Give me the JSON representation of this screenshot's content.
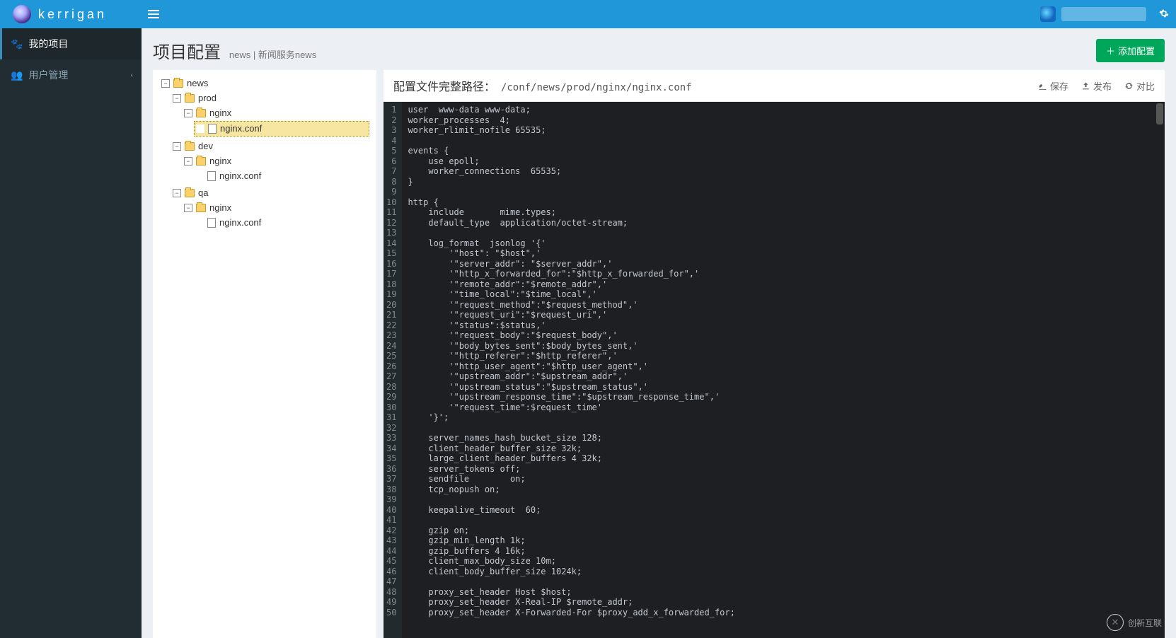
{
  "brand": "kerrigan",
  "sidebar": {
    "items": [
      {
        "label": "我的项目",
        "icon": "paw"
      },
      {
        "label": "用户管理",
        "icon": "users"
      }
    ]
  },
  "page": {
    "title": "项目配置",
    "crumb": "news | 新闻服务news",
    "addButton": "添加配置"
  },
  "tree": {
    "root": "news",
    "children": [
      {
        "name": "prod",
        "children": [
          {
            "name": "nginx",
            "children": [
              {
                "name": "nginx.conf",
                "file": true,
                "selected": true
              }
            ]
          }
        ]
      },
      {
        "name": "dev",
        "children": [
          {
            "name": "nginx",
            "children": [
              {
                "name": "nginx.conf",
                "file": true
              }
            ]
          }
        ]
      },
      {
        "name": "qa",
        "children": [
          {
            "name": "nginx",
            "children": [
              {
                "name": "nginx.conf",
                "file": true
              }
            ]
          }
        ]
      }
    ]
  },
  "editor": {
    "pathLabel": "配置文件完整路径：",
    "pathValue": "/conf/news/prod/nginx/nginx.conf",
    "actions": {
      "save": "保存",
      "publish": "发布",
      "diff": "对比"
    },
    "lines": [
      "user  www-data www-data;",
      "worker_processes  4;",
      "worker_rlimit_nofile 65535;",
      "",
      "events {",
      "    use epoll;",
      "    worker_connections  65535;",
      "}",
      "",
      "http {",
      "    include       mime.types;",
      "    default_type  application/octet-stream;",
      "",
      "    log_format  jsonlog '{'",
      "        '\"host\": \"$host\",'",
      "        '\"server_addr\": \"$server_addr\",'",
      "        '\"http_x_forwarded_for\":\"$http_x_forwarded_for\",'",
      "        '\"remote_addr\":\"$remote_addr\",'",
      "        '\"time_local\":\"$time_local\",'",
      "        '\"request_method\":\"$request_method\",'",
      "        '\"request_uri\":\"$request_uri\",'",
      "        '\"status\":$status,'",
      "        '\"request_body\":\"$request_body\",'",
      "        '\"body_bytes_sent\":$body_bytes_sent,'",
      "        '\"http_referer\":\"$http_referer\",'",
      "        '\"http_user_agent\":\"$http_user_agent\",'",
      "        '\"upstream_addr\":\"$upstream_addr\",'",
      "        '\"upstream_status\":\"$upstream_status\",'",
      "        '\"upstream_response_time\":\"$upstream_response_time\",'",
      "        '\"request_time\":$request_time'",
      "    '}';",
      "",
      "    server_names_hash_bucket_size 128;",
      "    client_header_buffer_size 32k;",
      "    large_client_header_buffers 4 32k;",
      "    server_tokens off;",
      "    sendfile        on;",
      "    tcp_nopush on;",
      "",
      "    keepalive_timeout  60;",
      "",
      "    gzip on;",
      "    gzip_min_length 1k;",
      "    gzip_buffers 4 16k;",
      "    client_max_body_size 10m;",
      "    client_body_buffer_size 1024k;",
      "",
      "    proxy_set_header Host $host;",
      "    proxy_set_header X-Real-IP $remote_addr;",
      "    proxy_set_header X-Forwarded-For $proxy_add_x_forwarded_for;"
    ]
  },
  "watermark": "创新互联"
}
